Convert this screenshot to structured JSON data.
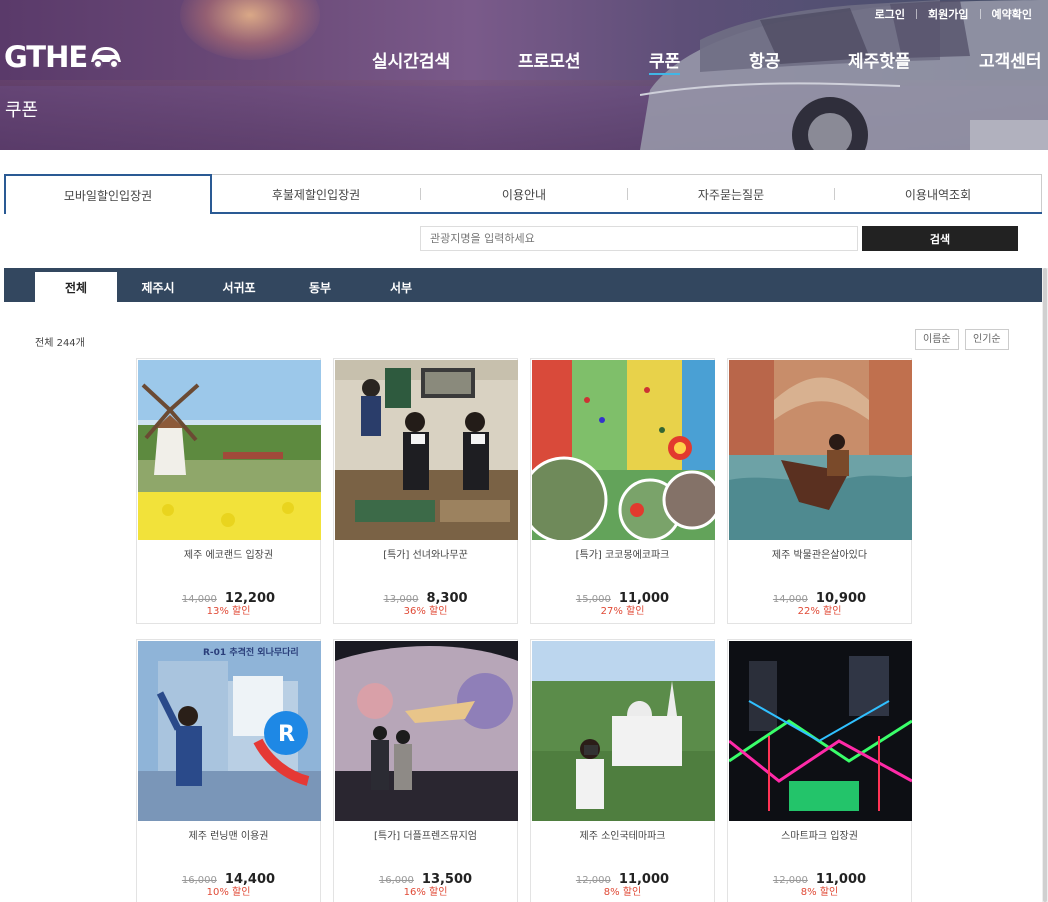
{
  "brand": {
    "logo_text": "GTHE"
  },
  "util_links": [
    "로그인",
    "회원가입",
    "예약확인"
  ],
  "gnb": [
    "실시간검색",
    "프로모션",
    "쿠폰",
    "항공",
    "제주핫플",
    "고객센터"
  ],
  "gnb_active": "쿠폰",
  "page_title": "쿠폰",
  "tabs": [
    "모바일할인입장권",
    "후불제할인입장권",
    "이용안내",
    "자주묻는질문",
    "이용내역조회"
  ],
  "tab_active": "모바일할인입장권",
  "search": {
    "placeholder": "관광지명을 입력하세요",
    "button": "검색"
  },
  "regions": [
    "전체",
    "제주시",
    "서귀포",
    "동부",
    "서부"
  ],
  "region_active": "전체",
  "result_count": "전체 244개",
  "sort": [
    "이름순",
    "인기순"
  ],
  "products": [
    {
      "name": "제주 에코랜드 입장권",
      "old_price": "14,000",
      "price": "12,200",
      "discount": "13% 할인"
    },
    {
      "name": "[특가] 선녀와나무꾼",
      "old_price": "13,000",
      "price": "8,300",
      "discount": "36% 할인"
    },
    {
      "name": "[특가] 코코몽에코파크",
      "old_price": "15,000",
      "price": "11,000",
      "discount": "27% 할인"
    },
    {
      "name": "제주 박물관은살아있다",
      "old_price": "14,000",
      "price": "10,900",
      "discount": "22% 할인"
    },
    {
      "name": "제주 런닝맨 이용권",
      "old_price": "16,000",
      "price": "14,400",
      "discount": "10% 할인"
    },
    {
      "name": "[특가] 더플프렌즈뮤지엄",
      "old_price": "16,000",
      "price": "13,500",
      "discount": "16% 할인"
    },
    {
      "name": "제주 소인국테마파크",
      "old_price": "12,000",
      "price": "11,000",
      "discount": "8% 할인"
    },
    {
      "name": "스마트파크 입장권",
      "old_price": "12,000",
      "price": "11,000",
      "discount": "8% 할인"
    }
  ],
  "thumb_banner_text": "R-01 추격전 외나무다리",
  "colors": {
    "tab_border": "#2a5a94",
    "region_bar": "#33475f",
    "discount": "#e04a36",
    "gnb_underline": "#41b6e6"
  }
}
